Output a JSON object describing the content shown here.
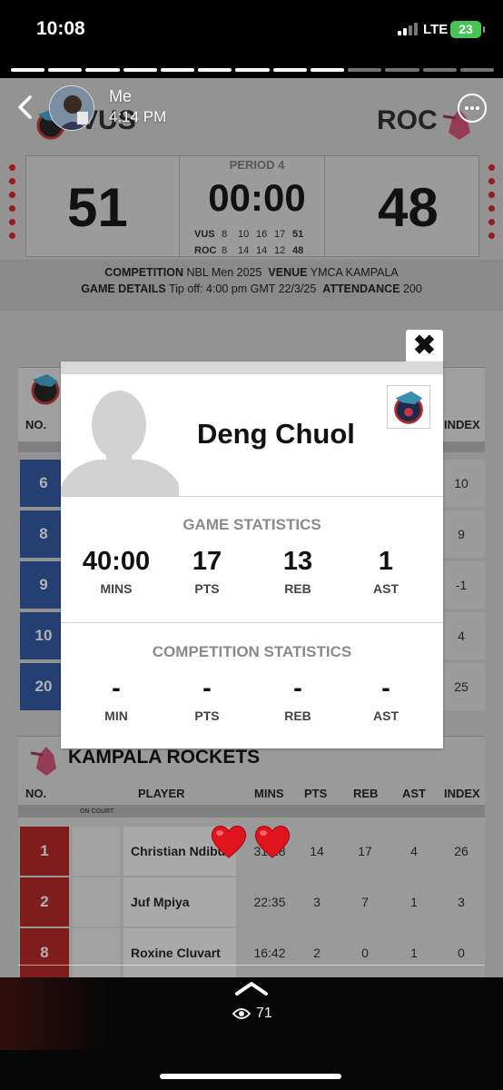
{
  "status_bar": {
    "time": "10:08",
    "network": "LTE",
    "battery": "23"
  },
  "story": {
    "user": "Me",
    "time": "4:14 PM",
    "progress": {
      "segments": 13,
      "completed": 9
    },
    "views": "71"
  },
  "scoreboard": {
    "home_abbr": "VUS",
    "away_abbr": "ROC",
    "home_score": "51",
    "away_score": "48",
    "period": "PERIOD 4",
    "clock": "00:00",
    "quarters": [
      {
        "team": "VUS",
        "q": [
          "8",
          "10",
          "16",
          "17"
        ],
        "total": "51"
      },
      {
        "team": "ROC",
        "q": [
          "8",
          "14",
          "14",
          "12"
        ],
        "total": "48"
      }
    ],
    "competition_label": "COMPETITION",
    "competition": "NBL Men 2025",
    "venue_label": "VENUE",
    "venue": "YMCA KAMPALA",
    "details_label": "GAME DETAILS",
    "details": "Tip off: 4:00 pm GMT 22/3/25",
    "attendance_label": "ATTENDANCE",
    "attendance": "200"
  },
  "vus_table": {
    "headers": {
      "no": "NO.",
      "index": "INDEX"
    },
    "rows": [
      {
        "no": "6",
        "index": "10"
      },
      {
        "no": "8",
        "index": "9"
      },
      {
        "no": "9",
        "index": "-1"
      },
      {
        "no": "10",
        "index": "4"
      },
      {
        "no": "20",
        "index": "25"
      }
    ]
  },
  "rockets_table": {
    "title": "KAMPALA ROCKETS",
    "headers": {
      "no": "NO.",
      "player": "PLAYER",
      "mins": "MINS",
      "pts": "PTS",
      "reb": "REB",
      "ast": "AST",
      "index": "INDEX"
    },
    "oncourt_label": "ON COURT",
    "rows": [
      {
        "no": "1",
        "player": "Christian Ndibu",
        "mins": "31:28",
        "pts": "14",
        "reb": "17",
        "ast": "4",
        "index": "26"
      },
      {
        "no": "2",
        "player": "Juf Mpiya",
        "mins": "22:35",
        "pts": "3",
        "reb": "7",
        "ast": "1",
        "index": "3"
      },
      {
        "no": "8",
        "player": "Roxine Cluvart",
        "mins": "16:42",
        "pts": "2",
        "reb": "0",
        "ast": "1",
        "index": "0"
      }
    ]
  },
  "modal": {
    "close_glyph": "✖",
    "player_name": "Deng Chuol",
    "game_stats_title": "GAME STATISTICS",
    "game_stats": [
      {
        "value": "40:00",
        "label": "MINS"
      },
      {
        "value": "17",
        "label": "PTS"
      },
      {
        "value": "13",
        "label": "REB"
      },
      {
        "value": "1",
        "label": "AST"
      }
    ],
    "comp_stats_title": "COMPETITION STATISTICS",
    "comp_stats": [
      {
        "value": "-",
        "label": "MIN"
      },
      {
        "value": "-",
        "label": "PTS"
      },
      {
        "value": "-",
        "label": "REB"
      },
      {
        "value": "-",
        "label": "AST"
      }
    ]
  },
  "colors": {
    "vus_blue": "#2e4d8b",
    "roc_red": "#9b2424",
    "battery_green": "#47c453",
    "heart_red": "#e0141e"
  },
  "icons": [
    "back-chevron-icon",
    "more-options-icon",
    "close-icon",
    "eye-icon",
    "chevron-up-icon",
    "heart-icon"
  ]
}
